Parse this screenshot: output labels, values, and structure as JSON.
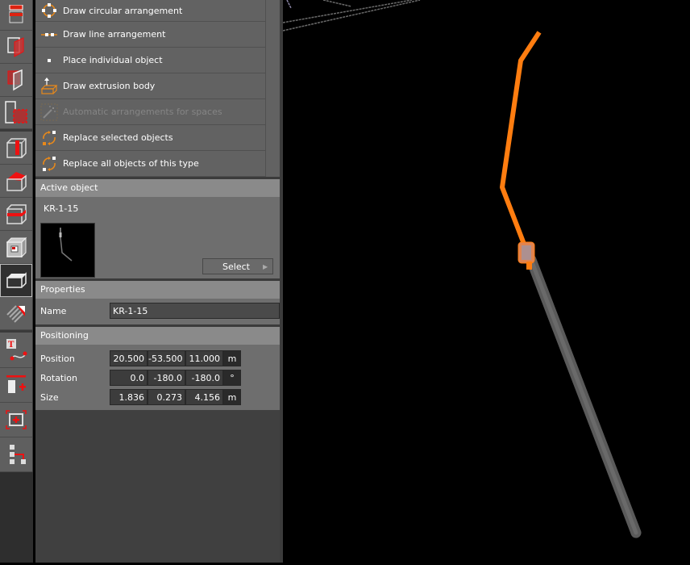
{
  "menu": {
    "items": [
      {
        "label": "Draw circular arrangement",
        "icon": "circular-arrangement-icon",
        "disabled": false
      },
      {
        "label": "Draw line arrangement",
        "icon": "line-arrangement-icon",
        "disabled": false
      },
      {
        "label": "Place individual object",
        "icon": "single-object-icon",
        "disabled": false
      },
      {
        "label": "Draw extrusion body",
        "icon": "extrusion-icon",
        "disabled": false
      },
      {
        "label": "Automatic arrangements for spaces",
        "icon": "magic-wand-icon",
        "disabled": true
      },
      {
        "label": "Replace selected objects",
        "icon": "replace-icon",
        "disabled": false
      },
      {
        "label": "Replace all objects of this type",
        "icon": "replace-all-icon",
        "disabled": false
      }
    ]
  },
  "active_object": {
    "title": "Active object",
    "name": "KR-1-15",
    "select_label": "Select"
  },
  "properties": {
    "title": "Properties",
    "name_label": "Name",
    "name_value": "KR-1-15"
  },
  "positioning": {
    "title": "Positioning",
    "rows": [
      {
        "label": "Position",
        "values": [
          "20.500",
          "-53.500",
          "11.000"
        ],
        "unit": "m"
      },
      {
        "label": "Rotation",
        "values": [
          "0.0",
          "-180.0",
          "-180.0"
        ],
        "unit": "°"
      },
      {
        "label": "Size",
        "values": [
          "1.836",
          "0.273",
          "4.156"
        ],
        "unit": "m"
      }
    ]
  },
  "colors": {
    "accent": "#ff7f11",
    "toolbar_red": "#e0141e",
    "panel_bg": "#626262",
    "section_head": "#8a8a8a"
  }
}
